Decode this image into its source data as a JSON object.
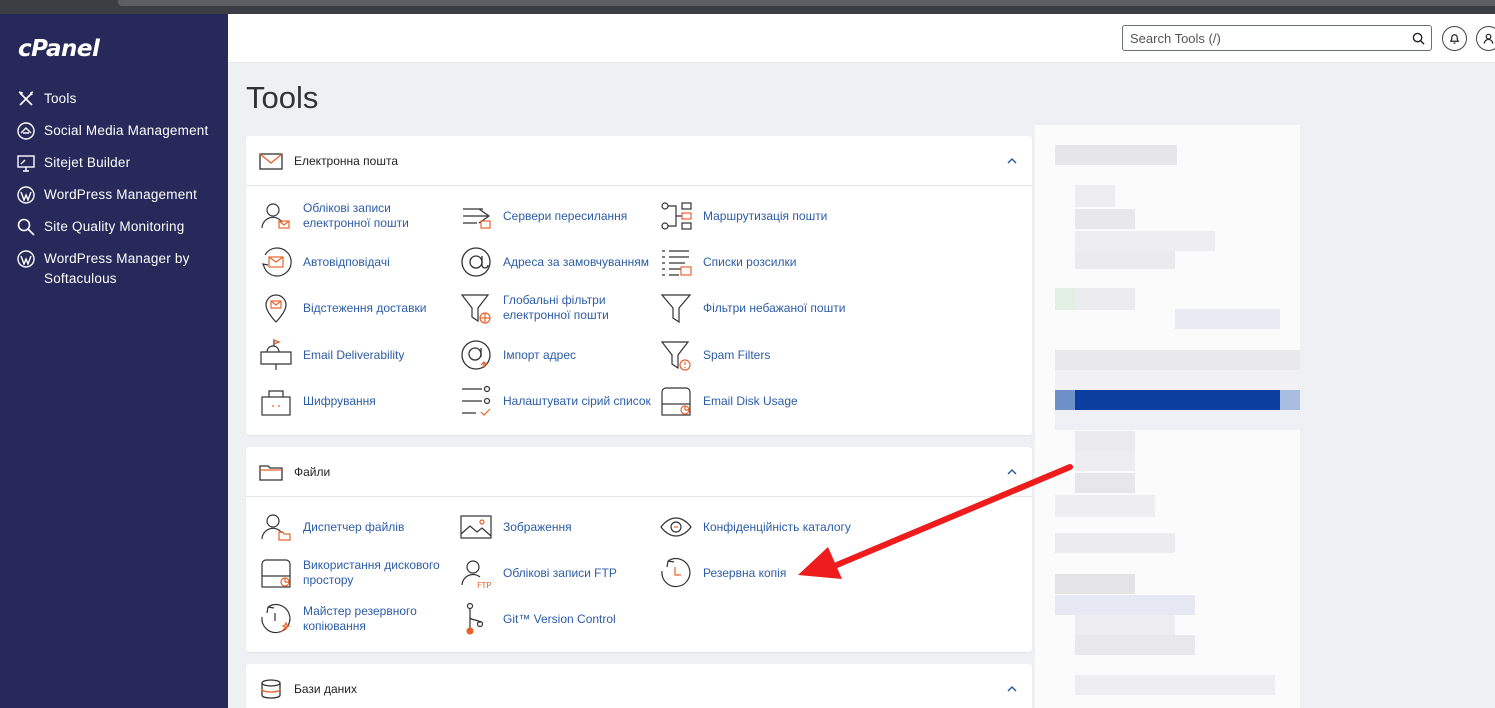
{
  "sidebar": {
    "logo": "cPanel",
    "items": [
      {
        "label": "Tools",
        "icon": "tools-icon"
      },
      {
        "label": "Social Media Management",
        "icon": "social-media-icon"
      },
      {
        "label": "Sitejet Builder",
        "icon": "sitejet-icon"
      },
      {
        "label": "WordPress Management",
        "icon": "wordpress-icon"
      },
      {
        "label": "Site Quality Monitoring",
        "icon": "magnifier-icon"
      },
      {
        "label": "WordPress Manager by Softaculous",
        "icon": "wordpress-icon"
      }
    ]
  },
  "topbar": {
    "search_placeholder": "Search Tools (/)",
    "icons": [
      "search-icon",
      "bell-icon",
      "user-icon"
    ]
  },
  "page": {
    "title": "Tools"
  },
  "sections": [
    {
      "title": "Електронна пошта",
      "icon": "envelope-icon",
      "tools": [
        {
          "label": "Облікові записи електронної пошти",
          "icon": "email-accounts-icon"
        },
        {
          "label": "Сервери пересилання",
          "icon": "forwarders-icon"
        },
        {
          "label": "Маршрутизація пошти",
          "icon": "email-routing-icon"
        },
        {
          "label": "Автовідповідачі",
          "icon": "autoresponders-icon"
        },
        {
          "label": "Адреса за замовчуванням",
          "icon": "at-sign-icon"
        },
        {
          "label": "Списки розсилки",
          "icon": "mailing-lists-icon"
        },
        {
          "label": "Відстеження доставки",
          "icon": "track-delivery-icon"
        },
        {
          "label": "Глобальні фільтри електронної пошти",
          "icon": "global-filters-icon"
        },
        {
          "label": "Фільтри небажаної пошти",
          "icon": "filter-icon"
        },
        {
          "label": "Email Deliverability",
          "icon": "mailbox-icon"
        },
        {
          "label": "Імпорт адрес",
          "icon": "import-icon"
        },
        {
          "label": "Spam Filters",
          "icon": "spam-filter-icon"
        },
        {
          "label": "Шифрування",
          "icon": "encryption-icon"
        },
        {
          "label": "Налаштувати сірий список",
          "icon": "greylist-icon"
        },
        {
          "label": "Email Disk Usage",
          "icon": "disk-usage-icon"
        }
      ]
    },
    {
      "title": "Файли",
      "icon": "folder-icon",
      "tools": [
        {
          "label": "Диспетчер файлів",
          "icon": "file-manager-icon"
        },
        {
          "label": "Зображення",
          "icon": "images-icon"
        },
        {
          "label": "Конфіденційність каталогу",
          "icon": "eye-icon"
        },
        {
          "label": "Використання дискового простору",
          "icon": "disk-usage-icon"
        },
        {
          "label": "Облікові записи FTP",
          "icon": "ftp-icon"
        },
        {
          "label": "Резервна копія",
          "icon": "backup-icon"
        },
        {
          "label": "Майстер резервного копіювання",
          "icon": "backup-wizard-icon"
        },
        {
          "label": "Git™ Version Control",
          "icon": "git-icon"
        }
      ]
    },
    {
      "title": "Бази даних",
      "icon": "database-icon",
      "tools": []
    }
  ],
  "colors": {
    "sidebar_bg": "#26295a",
    "link": "#2b5ca6",
    "accent_orange": "#e8642c",
    "annotation_arrow": "#ee1c1c"
  }
}
